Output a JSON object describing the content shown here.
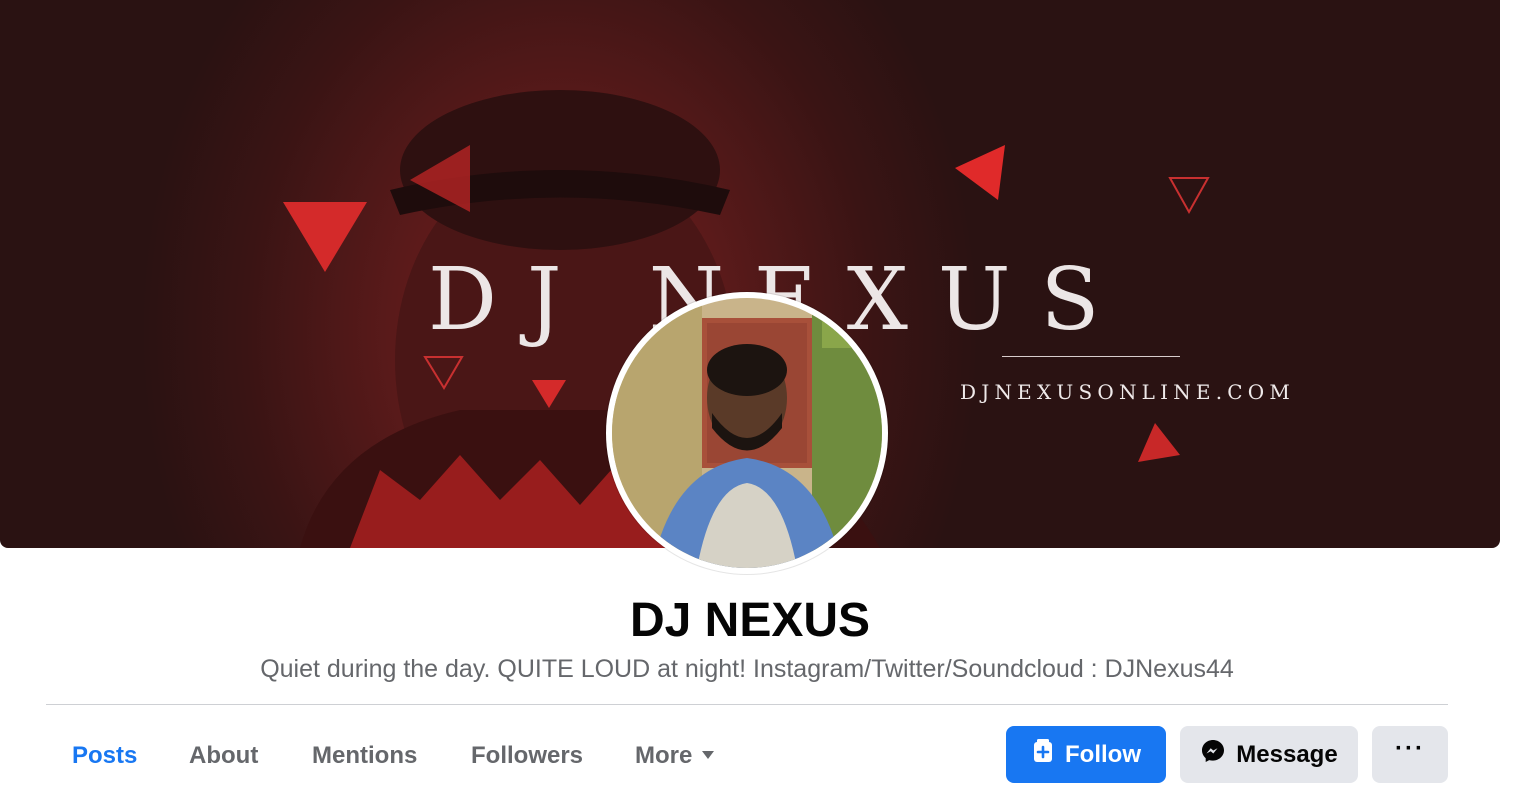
{
  "cover": {
    "brand_text": "DJ NEXUS",
    "url_text": "DJNEXUSONLINE.COM"
  },
  "profile": {
    "name": "DJ NEXUS",
    "bio": "Quiet during the day. QUITE LOUD at night! Instagram/Twitter/Soundcloud : DJNexus44"
  },
  "tabs": [
    {
      "label": "Posts",
      "active": true
    },
    {
      "label": "About"
    },
    {
      "label": "Mentions"
    },
    {
      "label": "Followers"
    },
    {
      "label": "More"
    }
  ],
  "actions": {
    "follow_label": "Follow",
    "message_label": "Message",
    "more_label": "···"
  },
  "colors": {
    "accent": "#1877f2",
    "secondary_button_bg": "#e4e6eb",
    "muted_text": "#65676b",
    "cover_red": "#c82828"
  }
}
